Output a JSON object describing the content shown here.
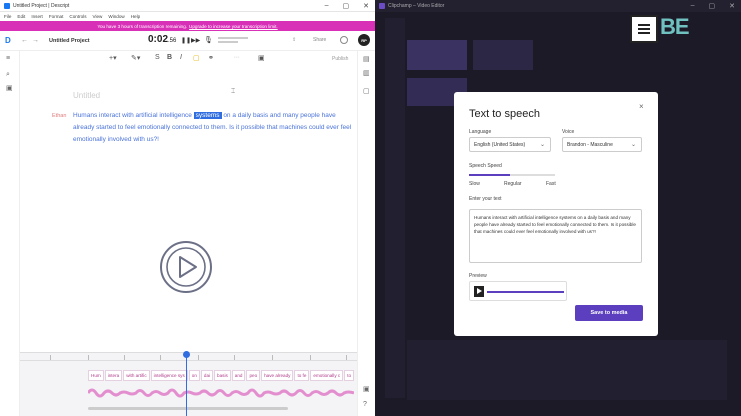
{
  "descript": {
    "window_title": "Untitled Project | Descript",
    "menu": [
      "File",
      "Edit",
      "Insert",
      "Format",
      "Controls",
      "View",
      "Window",
      "Help"
    ],
    "banner_text": "You have 3 hours of transcription remaining.",
    "banner_link": "Upgrade to increase your transcription limit.",
    "project_name": "Untitled Project",
    "time_main": "0:02",
    "time_frac": ".56",
    "share_label": "Share",
    "avatar_initials": "RP",
    "publish_label": "Publish",
    "doc_title": "Untitled",
    "speaker": "Ethan",
    "transcript_before": "Humans interact with artificial intelligence ",
    "transcript_selected": "systems",
    "transcript_after": " on a daily basis and many people have already started to feel emotionally connected to them. Is it possible that machines could ever feel emotionally involved with us?!",
    "timeline_words": [
      "Hum",
      "intera",
      "with artific",
      "intelligence sys",
      "on",
      "dai",
      "basis",
      "and",
      "peo",
      "have already",
      "to fe",
      "emotionally c",
      "to"
    ]
  },
  "clipchamp": {
    "window_title": "Clipchamp – Video Editor",
    "logo_text": "BE",
    "modal": {
      "title": "Text to speech",
      "close": "×",
      "language_label": "Language",
      "language_value": "English (United States)",
      "voice_label": "Voice",
      "voice_value": "Brandon - Masculine",
      "speed_label": "Speech Speed",
      "speed_slow": "Slow",
      "speed_regular": "Regular",
      "speed_fast": "Fast",
      "text_label": "Enter your text",
      "text_value": "Humans interact with artificial intelligence systems on a daily basis and many people have already started to feel emotionally connected to them. Is it possible that machines could ever feel emotionally involved with us?!",
      "preview_label": "Preview",
      "save_button": "Save to media"
    }
  },
  "colors": {
    "banner": "#d930b8",
    "accent_blue": "#2f6de1",
    "accent_purple": "#5b3fbf",
    "dark_bg": "#1d1a28"
  }
}
